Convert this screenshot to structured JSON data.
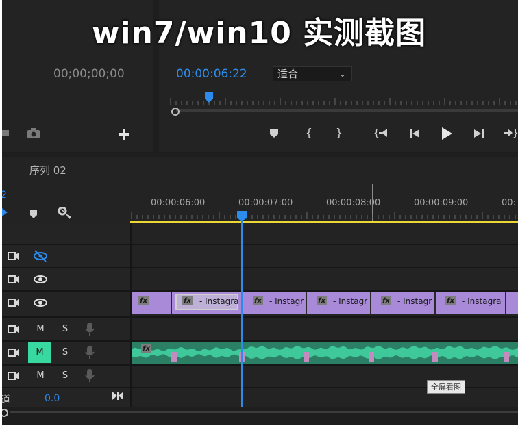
{
  "banner": {
    "text": "win7/win10 实测截图"
  },
  "source_monitor": {
    "timecode": "00;00;00;00"
  },
  "program_monitor": {
    "timecode": "00:00:06:22",
    "fit": {
      "selected": "适合"
    }
  },
  "timeline": {
    "sequence_title": "序列 02",
    "ruler_timecodes": [
      "00:00:06:00",
      "00:00:07:00",
      "00:00:08:00",
      "00:00:09:00",
      "00:"
    ],
    "tracks": {
      "audio_labels": {
        "mute": "M",
        "solo": "S"
      }
    },
    "clips": [
      {
        "label": ""
      },
      {
        "label": "- Instagra"
      },
      {
        "label": "- Instagr"
      },
      {
        "label": "- Instagr"
      },
      {
        "label": "- Instagr"
      },
      {
        "label": "- Instagra"
      },
      {
        "label": ""
      }
    ],
    "master": {
      "left_label": "道",
      "value": "0.0"
    }
  },
  "overlay_button": {
    "label": "全屏看图"
  },
  "colors": {
    "accent_blue": "#2d8ceb",
    "clip_purple": "#a88ad8",
    "audio_green": "#2fb384",
    "work_area_yellow": "#ecd834",
    "mute_active": "#38d9a0"
  }
}
